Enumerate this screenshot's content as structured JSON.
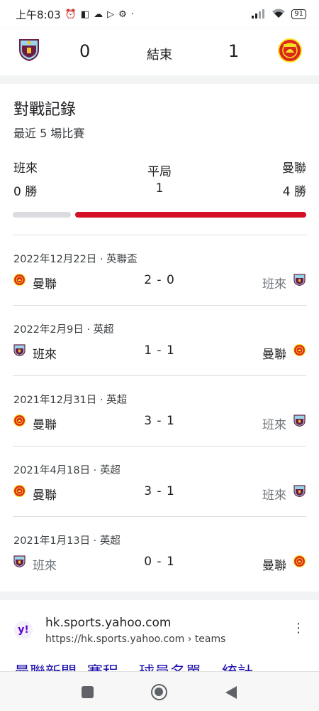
{
  "statusbar": {
    "time": "上午8:03",
    "battery": "91"
  },
  "header": {
    "home_score": "0",
    "status": "結束",
    "away_score": "1"
  },
  "h2h": {
    "title": "對戰記錄",
    "subtitle": "最近 5 場比賽",
    "left_team": "班來",
    "left_wins": "0 勝",
    "draw_label": "平局",
    "draws": "1",
    "right_team": "曼聯",
    "right_wins": "4 勝",
    "bar": {
      "left_fraction": 0.2,
      "right_fraction": 0.8,
      "left_color": "#dadce0",
      "right_color": "#d50f25"
    }
  },
  "matches": [
    {
      "date": "2022年12月22日 · 英聯盃",
      "left_team": "曼聯",
      "left_crest": "man-utd",
      "score": "2 - 0",
      "right_team": "班來",
      "right_crest": "burnley",
      "loser": "right"
    },
    {
      "date": "2022年2月9日 · 英超",
      "left_team": "班來",
      "left_crest": "burnley",
      "score": "1 - 1",
      "right_team": "曼聯",
      "right_crest": "man-utd",
      "loser": "none"
    },
    {
      "date": "2021年12月31日 · 英超",
      "left_team": "曼聯",
      "left_crest": "man-utd",
      "score": "3 - 1",
      "right_team": "班來",
      "right_crest": "burnley",
      "loser": "right"
    },
    {
      "date": "2021年4月18日 · 英超",
      "left_team": "曼聯",
      "left_crest": "man-utd",
      "score": "3 - 1",
      "right_team": "班來",
      "right_crest": "burnley",
      "loser": "right"
    },
    {
      "date": "2021年1月13日 · 英超",
      "left_team": "班來",
      "left_crest": "burnley",
      "score": "0 - 1",
      "right_team": "曼聯",
      "right_crest": "man-utd",
      "loser": "left"
    }
  ],
  "search_result": {
    "favicon": "y!",
    "site_name": "hk.sports.yahoo.com",
    "url": "https://hk.sports.yahoo.com › teams",
    "title": "曼聯新聞- 賽程 、球員名單 、統計"
  },
  "colors": {
    "burnley_claret": "#6c1d45",
    "burnley_blue": "#99d6ea",
    "manutd_red": "#da291c",
    "manutd_gold": "#fbe122",
    "link": "#1a0dab"
  }
}
